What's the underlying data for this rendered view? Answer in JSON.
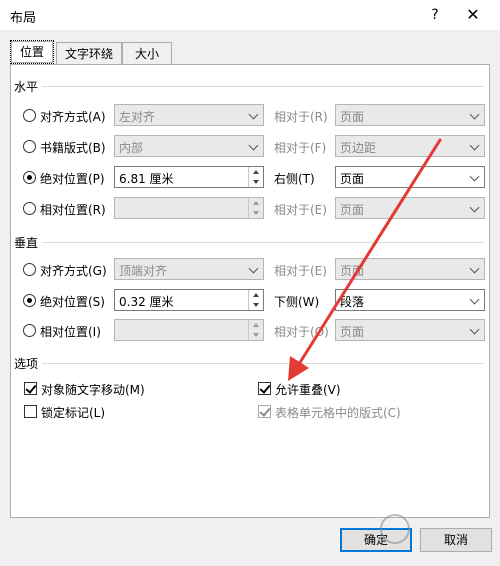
{
  "window": {
    "title": "布局",
    "help": "?",
    "close": "✕"
  },
  "tabs": [
    {
      "label": "位置"
    },
    {
      "label": "文字环绕"
    },
    {
      "label": "大小"
    }
  ],
  "horizontal": {
    "section": "水平",
    "rows": [
      {
        "label": "对齐方式(A)",
        "value": "左对齐",
        "rel_label": "相对于(R)",
        "rel_value": "页面"
      },
      {
        "label": "书籍版式(B)",
        "value": "内部",
        "rel_label": "相对于(F)",
        "rel_value": "页边距"
      },
      {
        "label": "绝对位置(P)",
        "value": "6.81 厘米",
        "rel_label": "右侧(T)",
        "rel_value": "页面"
      },
      {
        "label": "相对位置(R)",
        "value": "",
        "rel_label": "相对于(E)",
        "rel_value": "页面"
      }
    ]
  },
  "vertical": {
    "section": "垂直",
    "rows": [
      {
        "label": "对齐方式(G)",
        "value": "顶端对齐",
        "rel_label": "相对于(E)",
        "rel_value": "页面"
      },
      {
        "label": "绝对位置(S)",
        "value": "0.32 厘米",
        "rel_label": "下侧(W)",
        "rel_value": "段落"
      },
      {
        "label": "相对位置(I)",
        "value": "",
        "rel_label": "相对于(O)",
        "rel_value": "页面"
      }
    ]
  },
  "options": {
    "section": "选项",
    "move_with_text": "对象随文字移动(M)",
    "lock_anchor": "锁定标记(L)",
    "allow_overlap": "允许重叠(V)",
    "layout_in_cell": "表格单元格中的版式(C)"
  },
  "buttons": {
    "ok": "确定",
    "cancel": "取消"
  },
  "colors": {
    "annotation_arrow": "#e53935",
    "default_button_border": "#0078d7"
  }
}
